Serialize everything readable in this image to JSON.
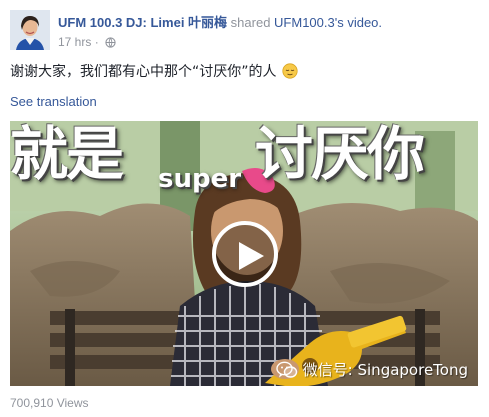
{
  "post": {
    "author": "UFM 100.3 DJ: Limei 叶丽梅",
    "shared_text": "shared",
    "shared_object": "UFM100.3's video.",
    "time": "17 hrs",
    "separator": "·",
    "privacy_icon": "globe-icon",
    "text": "谢谢大家，我们都有心中那个“讨厌你”的人",
    "emoji": "relieved-face-emoji",
    "see_translation": "See translation"
  },
  "video": {
    "overlay_left": "就是",
    "overlay_small": "super",
    "overlay_right": "讨厌你",
    "play_icon": "play-icon",
    "watermark": "微信号: SingaporeTong",
    "watermark_icon": "wechat-icon",
    "views": "700,910 Views"
  },
  "colors": {
    "link": "#365899",
    "meta": "#90949c",
    "text": "#1d2129"
  }
}
